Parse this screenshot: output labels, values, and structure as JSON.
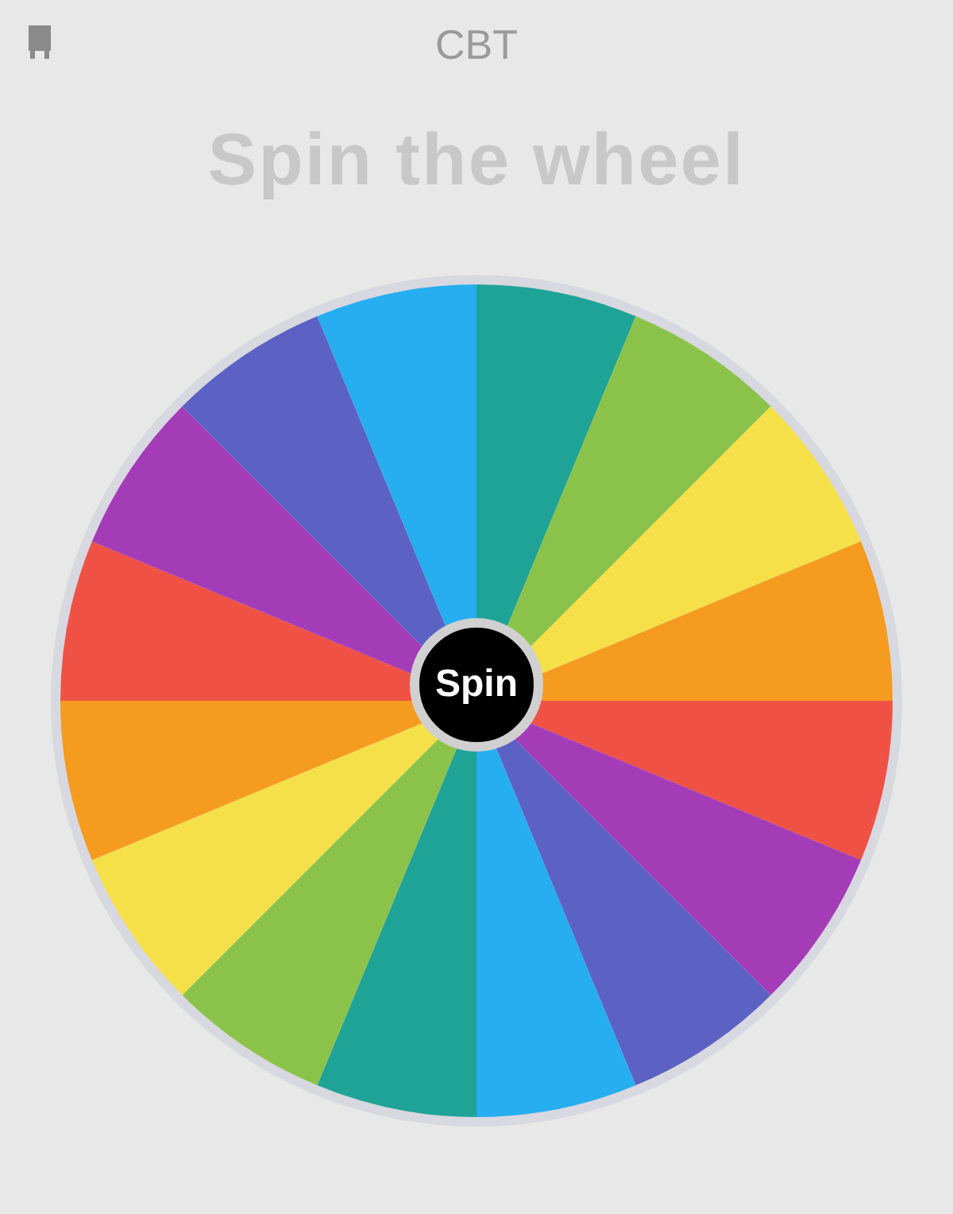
{
  "header": {
    "title": "CBT"
  },
  "heading": "Spin the wheel",
  "wheel": {
    "segments": [
      {
        "color": "#1fa396"
      },
      {
        "color": "#8bc34a"
      },
      {
        "color": "#f5e04a"
      },
      {
        "color": "#f59b1f"
      },
      {
        "color": "#ef5245"
      },
      {
        "color": "#a43cb8"
      },
      {
        "color": "#5c62c4"
      },
      {
        "color": "#26aef0"
      },
      {
        "color": "#1fa396"
      },
      {
        "color": "#8bc34a"
      },
      {
        "color": "#f5e04a"
      },
      {
        "color": "#f59b1f"
      },
      {
        "color": "#ef5245"
      },
      {
        "color": "#a43cb8"
      },
      {
        "color": "#5c62c4"
      },
      {
        "color": "#26aef0"
      }
    ],
    "button": "Spin"
  }
}
